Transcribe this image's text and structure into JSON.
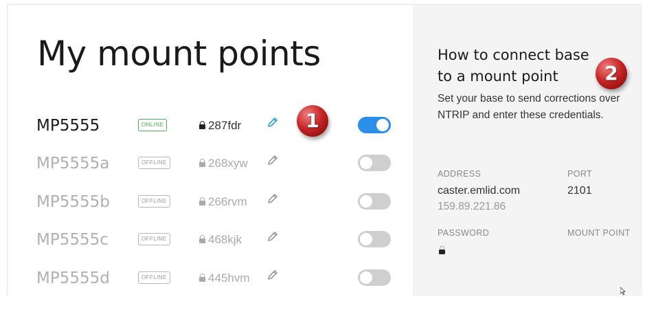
{
  "page": {
    "title": "My mount points"
  },
  "mount_points": [
    {
      "name": "MP5555",
      "status": "ONLINE",
      "password": "287fdr",
      "enabled": true
    },
    {
      "name": "MP5555a",
      "status": "OFFLINE",
      "password": "268xyw",
      "enabled": false
    },
    {
      "name": "MP5555b",
      "status": "OFFLINE",
      "password": "266rvm",
      "enabled": false
    },
    {
      "name": "MP5555c",
      "status": "OFFLINE",
      "password": "468kjk",
      "enabled": false
    },
    {
      "name": "MP5555d",
      "status": "OFFLINE",
      "password": "445hvm",
      "enabled": false
    }
  ],
  "markers": {
    "first": "1",
    "second": "2"
  },
  "help": {
    "heading_line1": "How to connect base",
    "heading_line2": "to a mount point",
    "description": "Set your base to send corrections over NTRIP and enter these credentials.",
    "address_label": "ADDRESS",
    "address_host": "caster.emlid.com",
    "address_ip": "159.89.221.86",
    "port_label": "PORT",
    "port_value": "2101",
    "password_label": "PASSWORD",
    "mount_point_label": "MOUNT POINT"
  },
  "colors": {
    "accent": "#2a8fe8",
    "online": "#4caf50",
    "marker": "#c62828"
  },
  "icons": [
    "lock-icon",
    "pencil-icon",
    "toggle-switch",
    "cursor-icon"
  ]
}
